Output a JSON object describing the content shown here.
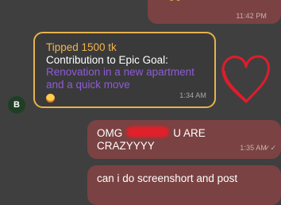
{
  "messages": {
    "top": {
      "time": "11:42 PM",
      "status_icon": "double-check-icon"
    },
    "tip": {
      "title": "Tipped 1500 tk",
      "goal_label": "Contribution to Epic Goal:",
      "goal_text": "Renovation in a new apartment and a quick move",
      "emoji": "smiling-face-icon",
      "time": "1:34 AM",
      "sender_initial": "B",
      "accent_color": "#e6b24c",
      "goal_color": "#8e5bd6"
    },
    "omg": {
      "line1_start": "OMG",
      "line1_end": "U ARE",
      "line2": "CRAZYYYY",
      "time": "1:35 AM",
      "status_icon": "double-check-icon"
    },
    "last": {
      "text": "can i do screenshort and post"
    }
  },
  "colors": {
    "background": "#3f3f3f",
    "outgoing_bubble": "#7a4242",
    "redaction": "#e0202a",
    "heart": "#e01c2c"
  }
}
